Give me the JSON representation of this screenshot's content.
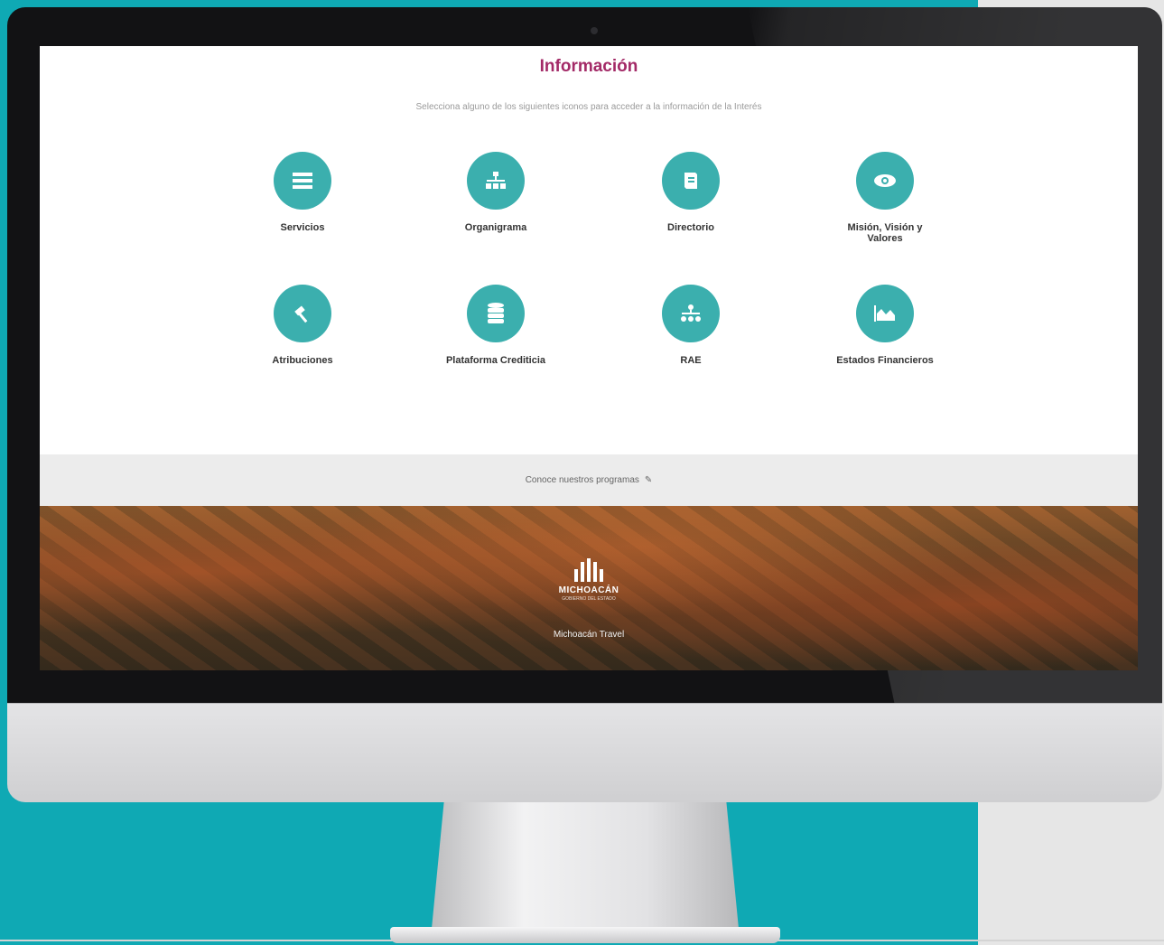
{
  "page": {
    "title": "Información",
    "subtitle": "Selecciona alguno de los siguientes iconos para acceder a la información de la Interés"
  },
  "cards": [
    {
      "label": "Servicios",
      "icon": "list-icon"
    },
    {
      "label": "Organigrama",
      "icon": "org-chart-icon"
    },
    {
      "label": "Directorio",
      "icon": "book-icon"
    },
    {
      "label": "Misión, Visión y Valores",
      "icon": "eye-icon"
    },
    {
      "label": "Atribuciones",
      "icon": "gavel-icon"
    },
    {
      "label": "Plataforma Crediticia",
      "icon": "database-icon"
    },
    {
      "label": "RAE",
      "icon": "hierarchy-icon"
    },
    {
      "label": "Estados Financieros",
      "icon": "area-chart-icon"
    }
  ],
  "programs_strip": {
    "label": "Conoce nuestros programas",
    "arrow": "✎"
  },
  "footer": {
    "logo_text": "MICHOACÁN",
    "logo_sub": "GOBIERNO DEL ESTADO",
    "caption": "Michoacán Travel"
  },
  "colors": {
    "accent_title": "#a32a67",
    "icon_circle": "#3bafae",
    "backdrop": "#0fa9b4"
  }
}
